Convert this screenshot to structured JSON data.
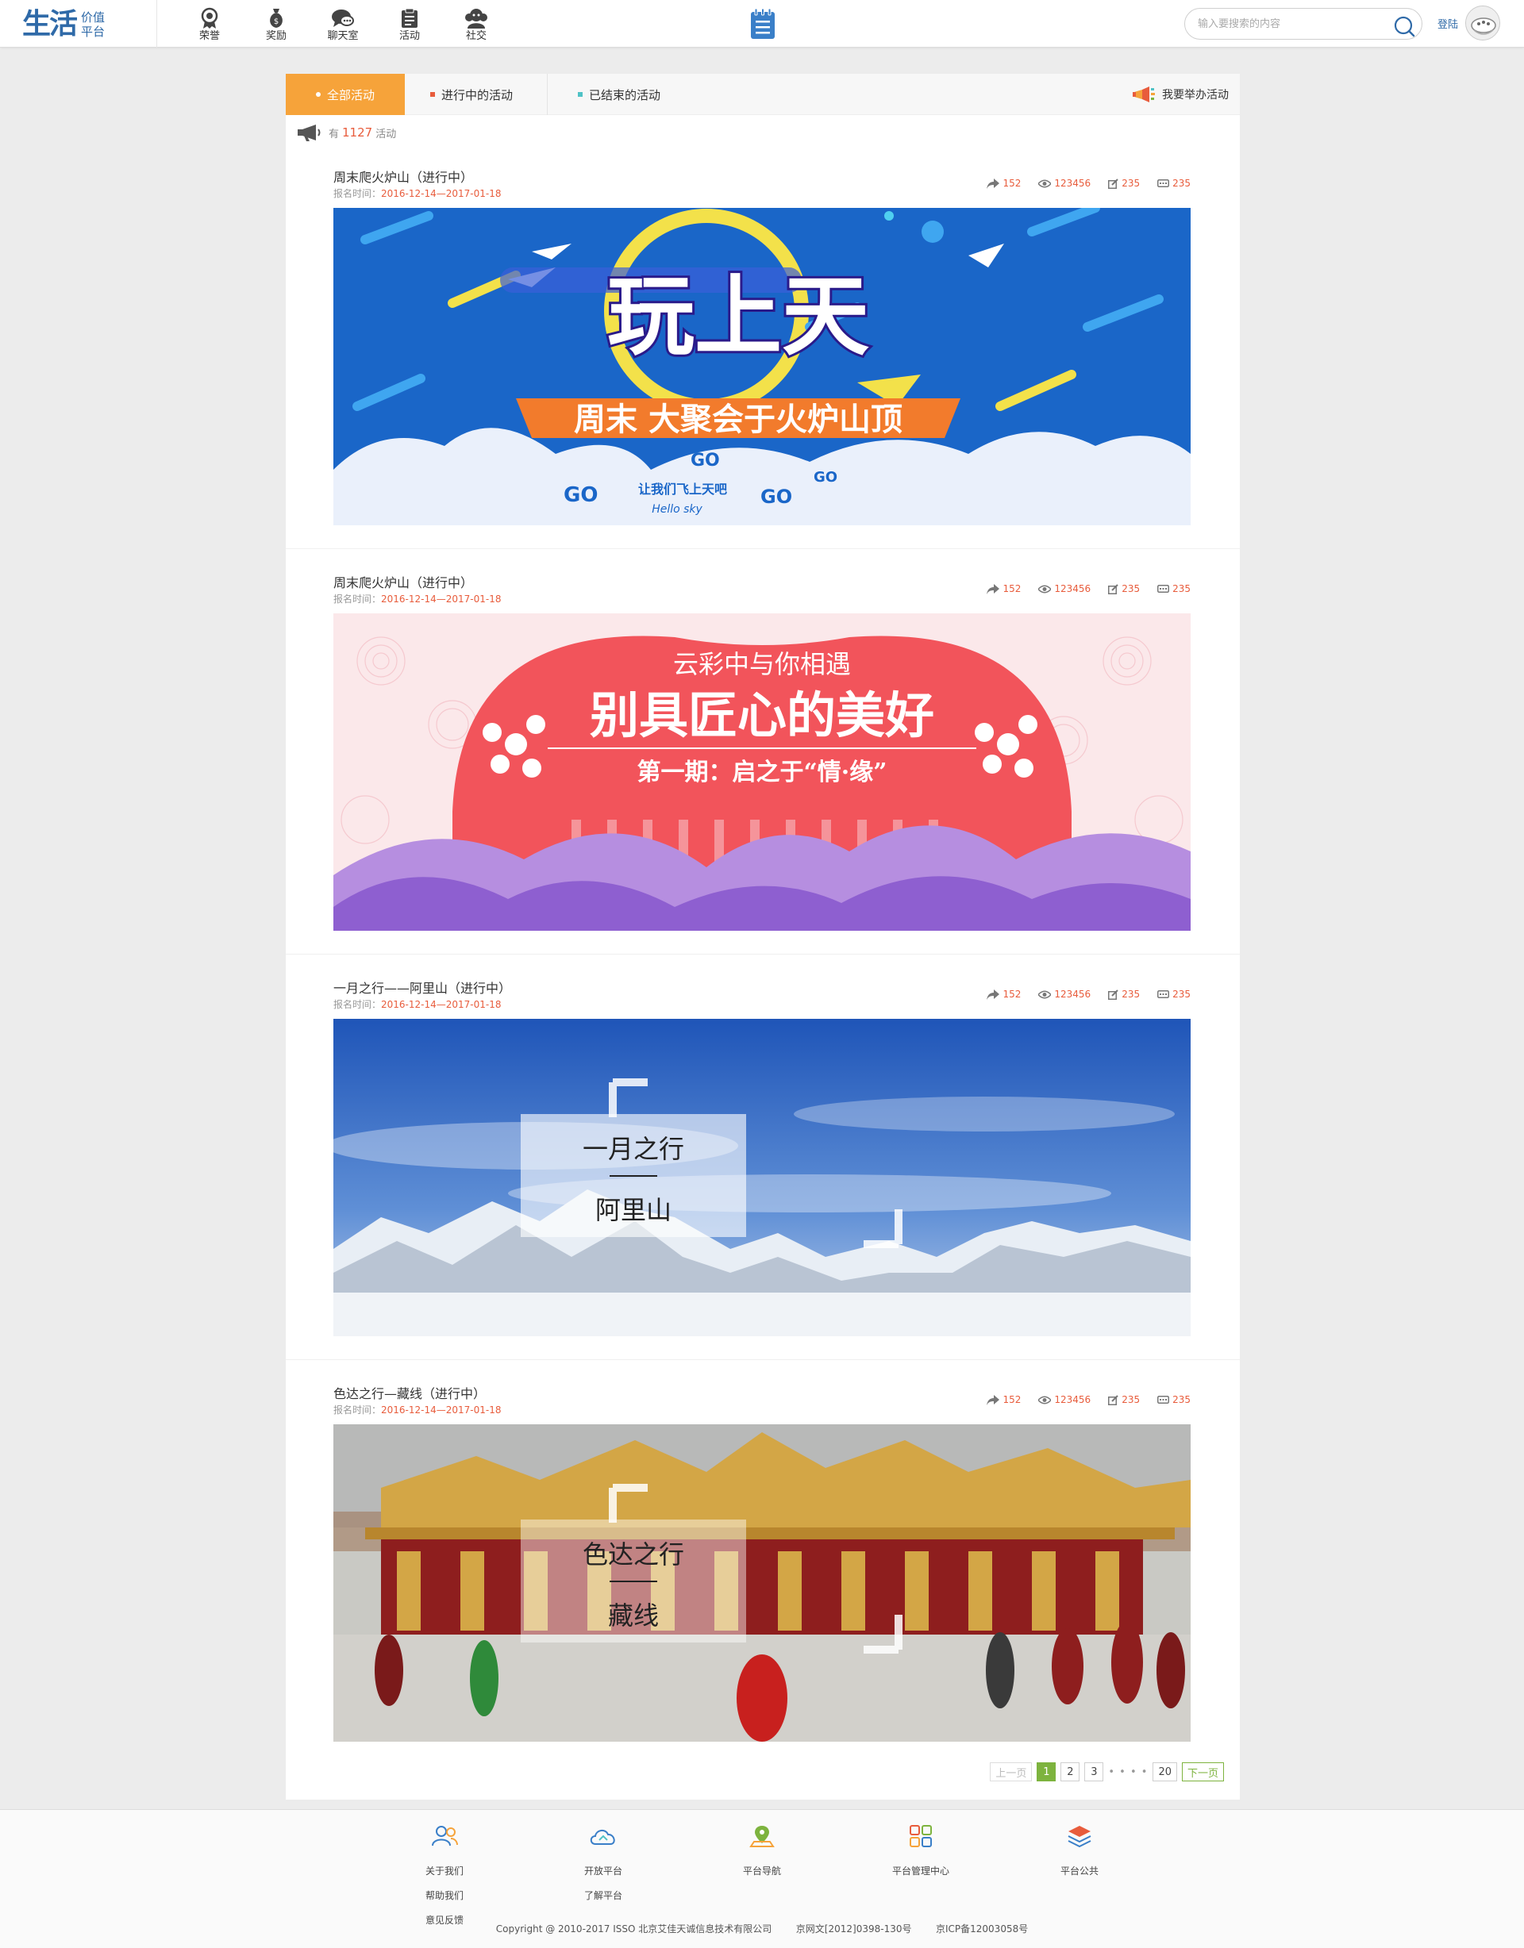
{
  "header": {
    "logo_main": "生活",
    "logo_sub_1": "价值",
    "logo_sub_2": "平台",
    "nav": [
      {
        "label": "荣誉",
        "icon": "medal-icon"
      },
      {
        "label": "奖励",
        "icon": "money-bag-icon"
      },
      {
        "label": "聊天室",
        "icon": "chat-icon"
      },
      {
        "label": "活动",
        "icon": "clipboard-icon"
      },
      {
        "label": "社交",
        "icon": "people-icon"
      }
    ],
    "search_placeholder": "输入要搜索的内容",
    "login_label": "登陆"
  },
  "tabs": {
    "all": "全部活动",
    "ongoing": "进行中的活动",
    "ended": "已结束的活动",
    "host": "我要举办活动"
  },
  "summary": {
    "prefix": "有",
    "count": "1127",
    "suffix": "活动"
  },
  "activities": [
    {
      "title": "周末爬火炉山（进行中）",
      "date_label": "报名时间：",
      "dates": "2016-12-14—2017-01-18",
      "shares": "152",
      "views": "123456",
      "edits": "235",
      "comments": "235",
      "banner": {
        "title": "玩上天",
        "subtitle": "周末 大聚会于火炉山顶",
        "tag1": "GO",
        "tag2": "GO",
        "tag3": "GO",
        "tag4": "GO",
        "slogan": "让我们飞上天吧",
        "slogan_en": "Hello sky"
      }
    },
    {
      "title": "周末爬火炉山（进行中）",
      "date_label": "报名时间：",
      "dates": "2016-12-14—2017-01-18",
      "shares": "152",
      "views": "123456",
      "edits": "235",
      "comments": "235",
      "banner": {
        "top": "云彩中与你相遇",
        "title": "别具匠心的美好",
        "subtitle": "第一期：启之于“情·缘”"
      }
    },
    {
      "title": "一月之行——阿里山（进行中）",
      "date_label": "报名时间：",
      "dates": "2016-12-14—2017-01-18",
      "shares": "152",
      "views": "123456",
      "edits": "235",
      "comments": "235",
      "banner": {
        "line1": "一月之行",
        "line2": "阿里山"
      }
    },
    {
      "title": "色达之行—藏线（进行中）",
      "date_label": "报名时间：",
      "dates": "2016-12-14—2017-01-18",
      "shares": "152",
      "views": "123456",
      "edits": "235",
      "comments": "235",
      "banner": {
        "line1": "色达之行",
        "line2": "藏线"
      }
    }
  ],
  "pagination": {
    "prev": "上一页",
    "pages": [
      "1",
      "2",
      "3"
    ],
    "ellipsis": "• • • •",
    "last": "20",
    "next": "下一页",
    "current": "1"
  },
  "footer": {
    "columns": [
      {
        "icon": "users-icon",
        "links": [
          "关于我们",
          "帮助我们",
          "意见反馈"
        ]
      },
      {
        "icon": "cloud-icon",
        "links": [
          "开放平台",
          "了解平台"
        ]
      },
      {
        "icon": "map-pin-icon",
        "links": [
          "平台导航"
        ]
      },
      {
        "icon": "grid-icon",
        "links": [
          "平台管理中心"
        ]
      },
      {
        "icon": "layers-icon",
        "links": [
          "平台公共"
        ]
      }
    ],
    "copyright": "Copyright @ 2010-2017 ISSO 北京艾佳天诚信息技术有限公司        京网文[2012]0398-130号        京ICP备12003058号"
  },
  "colors": {
    "brand_blue": "#2f6aa8",
    "accent_orange": "#f6a33a",
    "stat_red": "#e85c3c",
    "page_green": "#7db33e"
  }
}
